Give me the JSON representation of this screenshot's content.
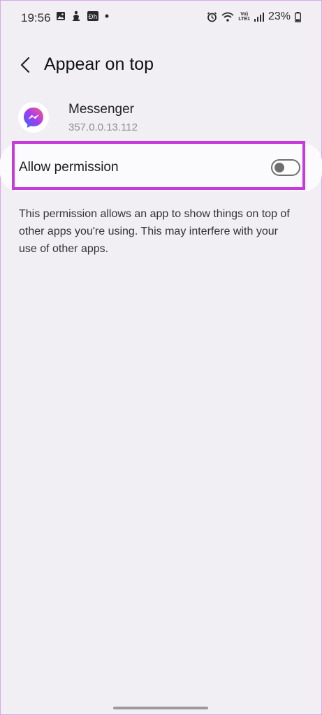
{
  "status_bar": {
    "time": "19:56",
    "network_label_top": "Vo)",
    "network_label_bottom": "LTE1",
    "battery": "23%"
  },
  "header": {
    "title": "Appear on top"
  },
  "app": {
    "name": "Messenger",
    "version": "357.0.0.13.112"
  },
  "permission": {
    "label": "Allow permission",
    "enabled": false
  },
  "description": "This permission allows an app to show things on top of other apps you're using. This may interfere with your use of other apps.",
  "colors": {
    "background": "#f1eff4",
    "card": "#fbfbfd",
    "highlight": "#c73bdc",
    "toggle_off": "#6f6f6f"
  }
}
